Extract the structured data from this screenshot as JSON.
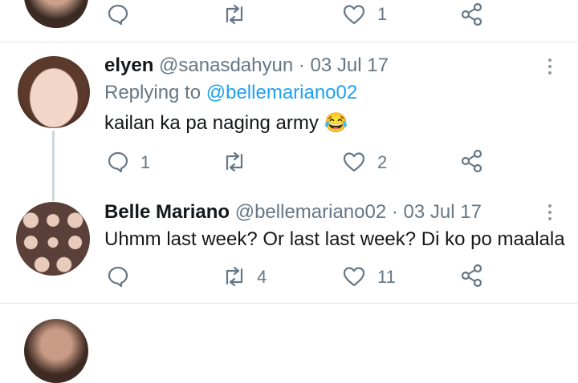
{
  "top_tweet": {
    "like_count": "1"
  },
  "reply1": {
    "name": "elyen",
    "handle": "@sanasdahyun",
    "date": "· 03 Jul 17",
    "replying_prefix": "Replying to",
    "replying_handle": "@bellemariano02",
    "text": "kailan ka pa naging army",
    "emoji": "😂",
    "reply_count": "1",
    "retweet_count": "",
    "like_count": "2"
  },
  "reply2": {
    "name": "Belle Mariano",
    "handle": "@bellemariano02",
    "date": "· 03 Jul 17",
    "text": "Uhmm last week? Or last last week? Di ko po maalala",
    "reply_count": "",
    "retweet_count": "4",
    "like_count": "11"
  },
  "colors": {
    "accent": "#1da1f2",
    "icon": "#657786",
    "divider": "#e1e8ed"
  },
  "icons": [
    "reply-icon",
    "retweet-icon",
    "like-icon",
    "share-icon",
    "more-icon"
  ]
}
